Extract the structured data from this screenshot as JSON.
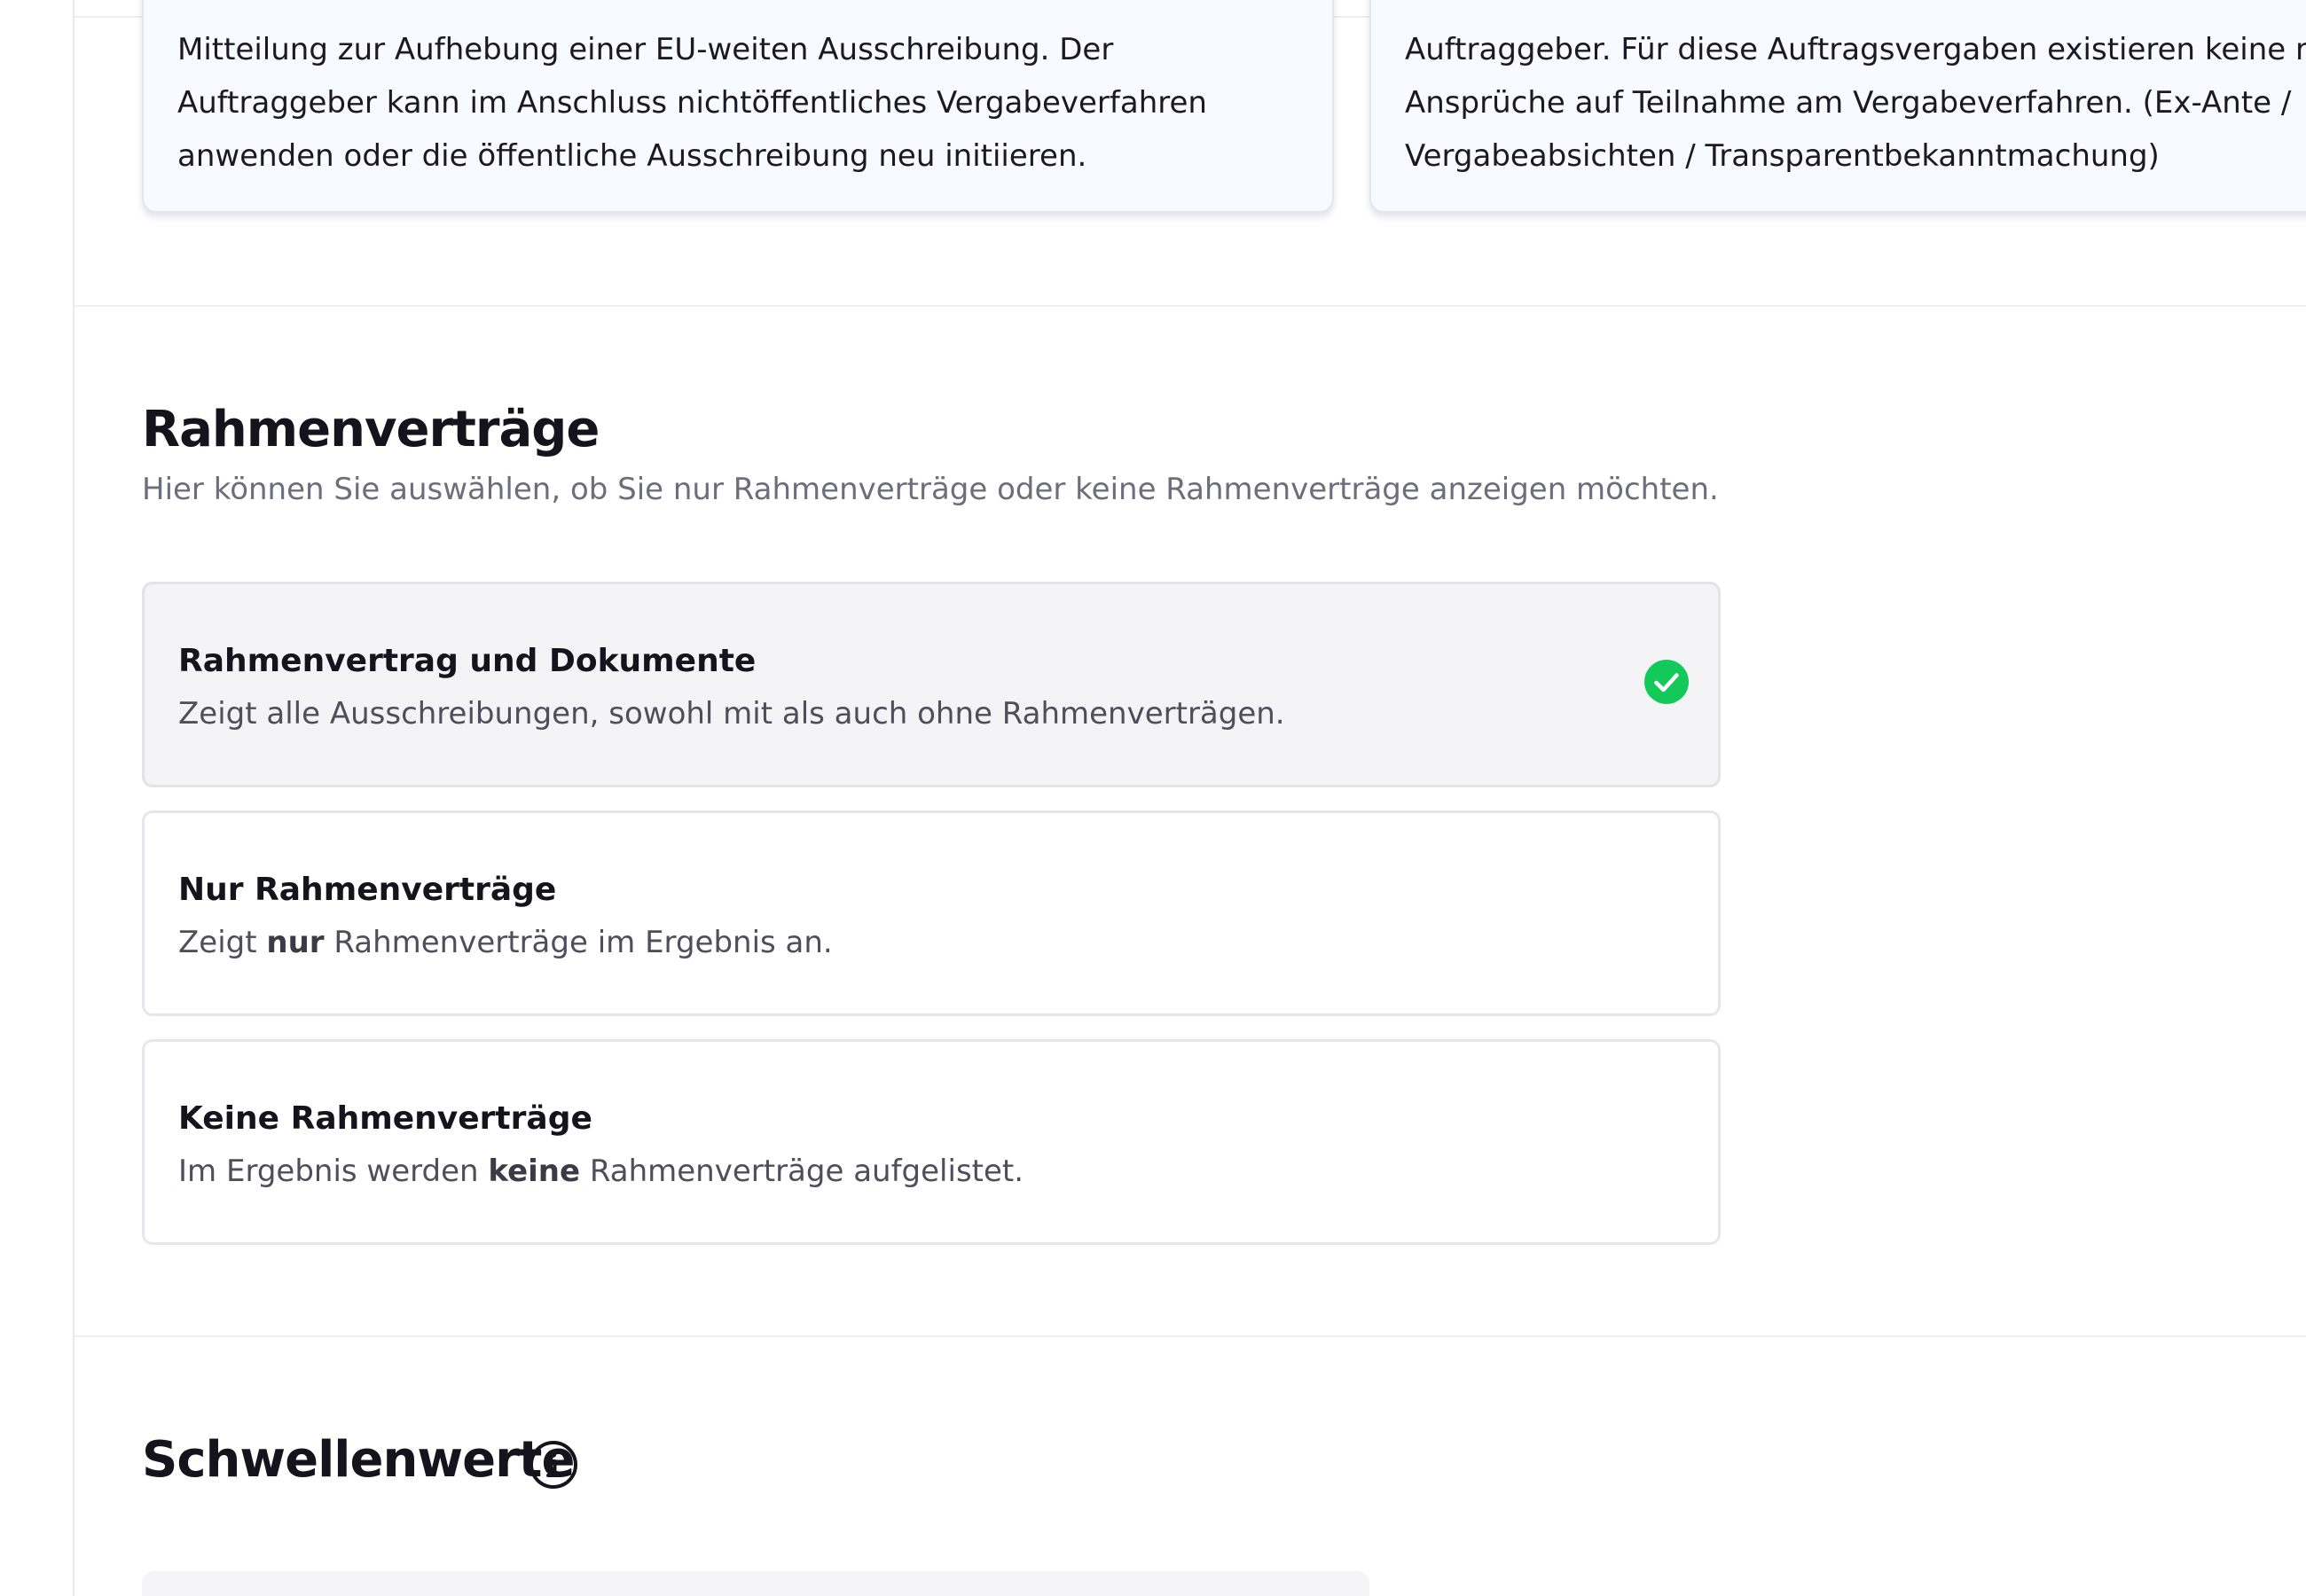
{
  "cards": [
    {
      "lines": [
        "Mitteilung zur Aufhebung einer EU-weiten Ausschreibung. Der",
        "Auftraggeber kann im Anschluss nichtöffentliches Vergabeverfahren",
        "anwenden oder die öffentliche Ausschreibung neu initiieren."
      ]
    },
    {
      "lines": [
        "Auftraggeber. Für diese Auftragsvergaben existieren keine rech",
        "Ansprüche auf Teilnahme am Vergabeverfahren. (Ex-Ante /",
        "Vergabeabsichten / Transparentbekanntmachung)"
      ]
    }
  ],
  "rahmen": {
    "title": "Rahmenverträge",
    "subtitle": "Hier können Sie auswählen, ob Sie nur Rahmenverträge oder keine Rahmenverträge anzeigen möchten.",
    "options": [
      {
        "title": "Rahmenvertrag und Dokumente",
        "desc": "Zeigt alle Ausschreibungen, sowohl mit als auch ohne Rahmenverträgen.",
        "selected": true
      },
      {
        "title": "Nur Rahmenverträge",
        "desc_pre": "Zeigt ",
        "desc_bold": "nur",
        "desc_post": " Rahmenverträge im Ergebnis an.",
        "selected": false
      },
      {
        "title": "Keine Rahmenverträge",
        "desc_pre": "Im Ergebnis werden ",
        "desc_bold": "keine",
        "desc_post": " Rahmenverträge aufgelistet.",
        "selected": false
      }
    ]
  },
  "schwellen": {
    "title": "Schwellenwerte"
  },
  "icons": {
    "selected": "check-circle-icon",
    "info": "info-icon"
  },
  "colors": {
    "accent_green": "#13c95a",
    "selected_bg": "#f4f4f7",
    "card_bg": "#f7faff"
  }
}
